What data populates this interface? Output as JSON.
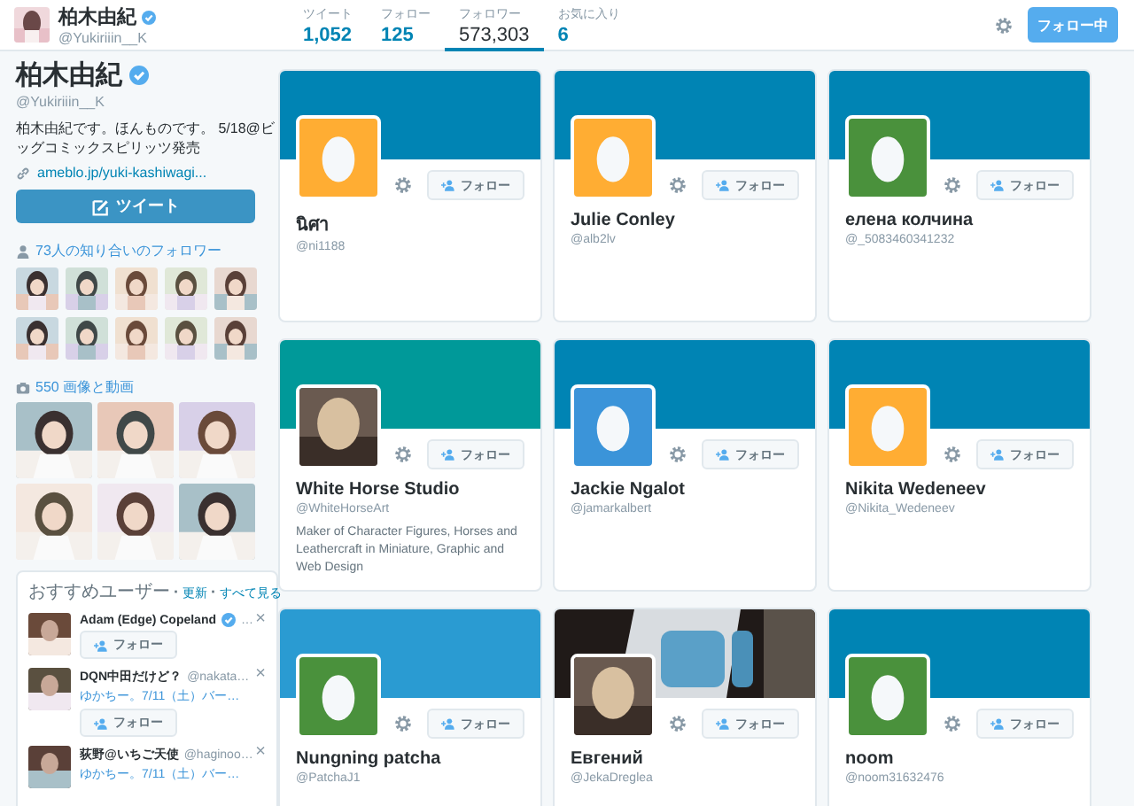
{
  "header": {
    "name": "柏木由紀",
    "verified": true,
    "handle": "@Yukiriiin__K",
    "stats": [
      {
        "label": "ツイート",
        "value": "1,052",
        "selected": false
      },
      {
        "label": "フォロー",
        "value": "125",
        "selected": false
      },
      {
        "label": "フォロワー",
        "value": "573,303",
        "selected": true
      },
      {
        "label": "お気に入り",
        "value": "6",
        "selected": false
      }
    ],
    "follow_button": "フォロー中"
  },
  "profile": {
    "name": "柏木由紀",
    "verified": true,
    "handle": "@Yukiriiin__K",
    "bio": "柏木由紀です。ほんものです。 5/18@ビッグコミックスピリッツ発売",
    "link": "ameblo.jp/yuki-kashiwagi...",
    "tweet_button": "ツイート",
    "known_followers": "73人の知り合いのフォロワー",
    "media": "550 画像と動画"
  },
  "recommended": {
    "title": "おすすめユーザー",
    "separator": "·",
    "links": [
      "更新",
      "すべて見る"
    ],
    "close": "×",
    "users": [
      {
        "name": "Adam (Edge) Copeland",
        "verified": true,
        "handle": "…",
        "follow": "フォロー"
      },
      {
        "name": "DQN中田だけど？",
        "verified": false,
        "handle": "@nakata…",
        "tweet": "ゆかちー。7/11（土）バー…",
        "follow": "フォロー"
      },
      {
        "name": "荻野@いちご天使",
        "verified": false,
        "handle": "@haginoo…",
        "tweet": "ゆかちー。7/11（土）バー…"
      }
    ]
  },
  "cards": [
    {
      "name": "นิศา",
      "handle": "@ni1188",
      "avatar": {
        "kind": "egg",
        "color": "#ffad33"
      },
      "banner": {
        "color": "#0084b4"
      },
      "follow": "フォロー"
    },
    {
      "name": "Julie Conley",
      "handle": "@alb2lv",
      "avatar": {
        "kind": "egg",
        "color": "#ffad33"
      },
      "banner": {
        "color": "#0084b4"
      },
      "follow": "フォロー"
    },
    {
      "name": "елена колчина",
      "handle": "@_5083460341232",
      "avatar": {
        "kind": "egg",
        "color": "#4a913c"
      },
      "banner": {
        "color": "#0084b4"
      },
      "follow": "フォロー"
    },
    {
      "name": "White Horse Studio",
      "handle": "@WhiteHorseArt",
      "bio": "Maker of Character Figures, Horses and Leathercraft in Miniature, Graphic and Web Design",
      "banner": {
        "color": "#009999"
      },
      "follow": "フォロー"
    },
    {
      "name": "Jackie Ngalot",
      "handle": "@jamarkalbert",
      "avatar": {
        "kind": "egg",
        "color": "#3b94d9"
      },
      "banner": {
        "color": "#0084b4"
      },
      "follow": "フォロー"
    },
    {
      "name": "Nikita Wedeneev",
      "handle": "@Nikita_Wedeneev",
      "avatar": {
        "kind": "egg",
        "color": "#ffad33"
      },
      "banner": {
        "color": "#0084b4"
      },
      "follow": "フォロー"
    },
    {
      "name": "Nungning patcha",
      "handle": "@PatchaJ1",
      "avatar": {
        "kind": "egg",
        "color": "#4a913c"
      },
      "banner": {
        "color": "#2a9bd2"
      },
      "follow": "フォロー"
    },
    {
      "name": "Евгений",
      "handle": "@JekaDreglea",
      "follow": "フォロー"
    },
    {
      "name": "noom",
      "handle": "@noom31632476",
      "avatar": {
        "kind": "egg",
        "color": "#4a913c"
      },
      "banner": {
        "color": "#0084b4"
      },
      "follow": "フォロー"
    }
  ]
}
